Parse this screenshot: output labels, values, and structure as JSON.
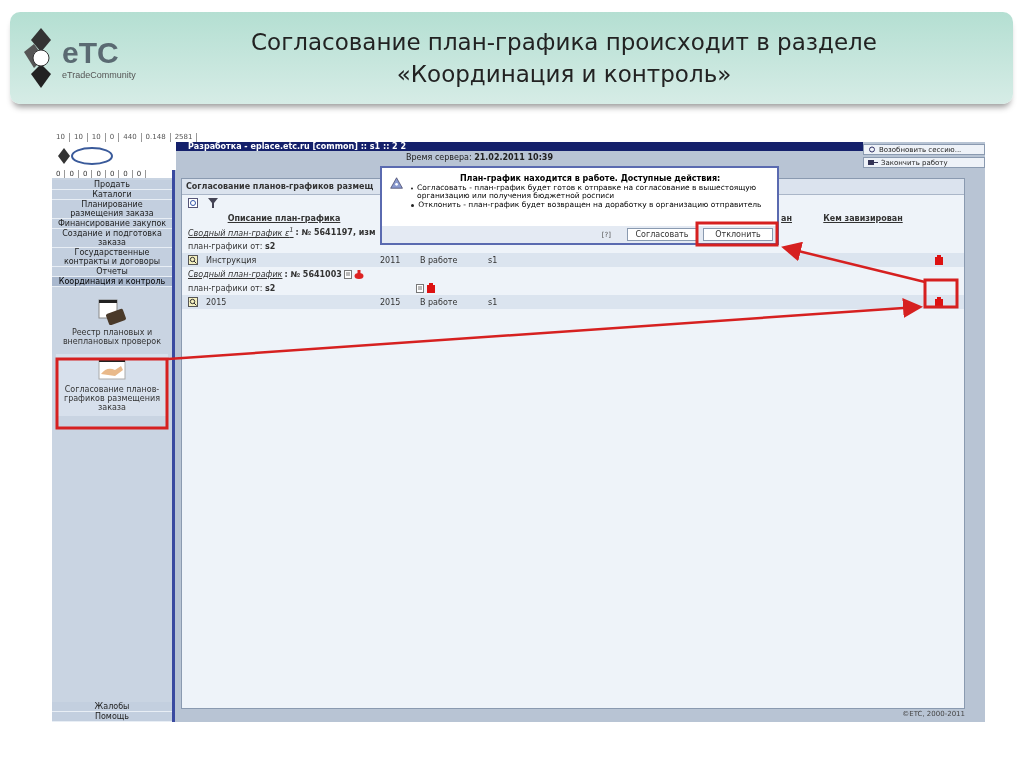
{
  "slide": {
    "logo": {
      "text": "eTC",
      "tagline": "eTradeCommunity"
    },
    "title": "Согласование план-графика происходит в разделе «Координация и контроль»"
  },
  "app": {
    "stats": [
      "10",
      "10",
      "10",
      "0",
      "440",
      "0.148",
      "2581"
    ],
    "title": "Разработка - eplace.etc.ru [common] :: s1 :: 2 2",
    "server_time_label": "Время сервера:",
    "server_time": "21.02.2011 10:39",
    "top_buttons": [
      {
        "label": "Возобновить сессию...",
        "kind": "resume"
      },
      {
        "label": "Закончить работу",
        "kind": "exit"
      }
    ],
    "counters": [
      "0",
      "0",
      "0",
      "0",
      "0",
      "0",
      "0"
    ],
    "sidebar": {
      "menu": [
        {
          "label": "Продать",
          "selected": false
        },
        {
          "label": "Каталоги",
          "selected": false
        },
        {
          "label": "Планирование размещения заказа",
          "selected": false
        },
        {
          "label": "Финансирование закупок",
          "selected": false
        },
        {
          "label": "Создание и подготовка заказа",
          "selected": false
        },
        {
          "label": "Государственные контракты и договоры",
          "selected": false
        },
        {
          "label": "Отчеты",
          "selected": false
        },
        {
          "label": "Координация и контроль",
          "selected": true
        }
      ],
      "tools": [
        {
          "label": "Реестр плановых и внеплановых проверок",
          "kind": "book",
          "selected": false
        },
        {
          "label": "Согласование планов-графиков размещения заказа",
          "kind": "handshake",
          "selected": true
        }
      ],
      "bottom": [
        "Жалобы",
        "Помощь"
      ]
    },
    "panel": {
      "title": "Согласование планов-графиков размещ",
      "columns": [
        "Описание план-графика",
        "ан",
        "Кем завизирован"
      ],
      "rows": [
        {
          "kind": "summary",
          "link": "Сводный план-график ε$^{1}$",
          "number": ": № 5641197, изм",
          "actions": false
        },
        {
          "kind": "from",
          "label": "план-графики от:",
          "value": "s2",
          "actions": false
        },
        {
          "kind": "item",
          "name": "Инструкция",
          "year": "2011",
          "status": "В работе",
          "user": "s1"
        },
        {
          "kind": "summary",
          "link": "Сводный план-график",
          "number": ": № 5641003",
          "actions": true
        },
        {
          "kind": "from",
          "label": "план-графики от:",
          "value": "s2",
          "actions": true
        },
        {
          "kind": "item",
          "name": "2015",
          "year": "2015",
          "status": "В работе",
          "user": "s1"
        }
      ]
    },
    "dialog": {
      "title": "План-график находится в работе. Доступные действия:",
      "bullets": [
        "Согласовать - план-график будет готов к отправке на согласование в вышестоящую организацию или получения бюджетной росписи",
        "Отклонить - план-график будет возвращен на доработку в организацию отправитель"
      ],
      "help": "[?]",
      "buttons": [
        "Согласовать",
        "Отклонить"
      ]
    },
    "footer": "©ETC, 2000-2011"
  }
}
